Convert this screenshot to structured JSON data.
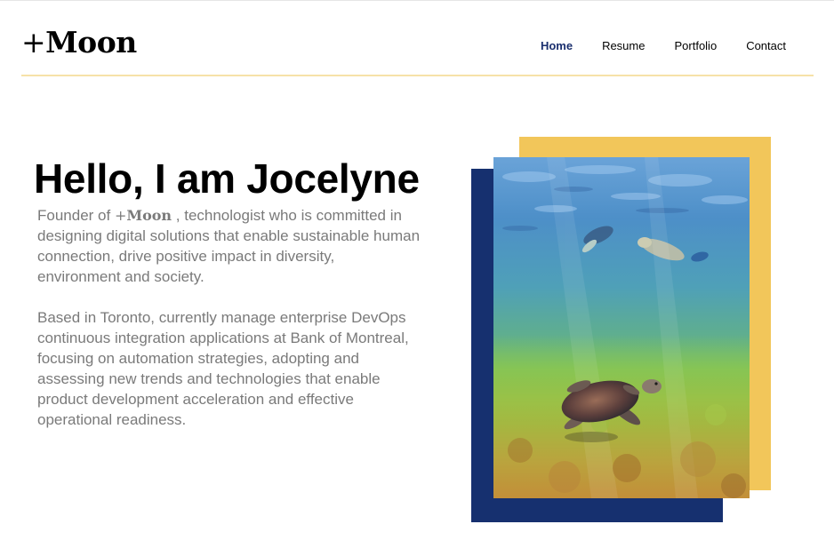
{
  "header": {
    "logo_plus": "+",
    "logo_text": "Moon",
    "nav": [
      {
        "label": "Home",
        "active": true
      },
      {
        "label": "Resume",
        "active": false
      },
      {
        "label": "Portfolio",
        "active": false
      },
      {
        "label": "Contact",
        "active": false
      }
    ]
  },
  "hero": {
    "title": "Hello, I am Jocelyne",
    "bio_p1_prefix": "Founder of ",
    "bio_p1_brand_plus": "+",
    "bio_p1_brand": "Moon",
    "bio_p1_suffix": " , technologist who is committed in designing digital solutions that enable sustainable human connection, drive positive impact in diversity, environment and society.",
    "bio_p2": "Based in Toronto, currently manage enterprise DevOps continuous integration applications at Bank of Montreal, focusing on automation strategies, adopting and assessing new trends and technologies that enable product development acceleration and effective operational readiness."
  },
  "colors": {
    "accent_yellow": "#f2c65a",
    "accent_navy": "#16306f",
    "nav_active": "#1a2f6e",
    "body_text": "#7a7a7a",
    "header_rule": "#f6e2a8"
  },
  "photo": {
    "subject": "underwater-sea-turtle-with-snorkelers-photo"
  }
}
